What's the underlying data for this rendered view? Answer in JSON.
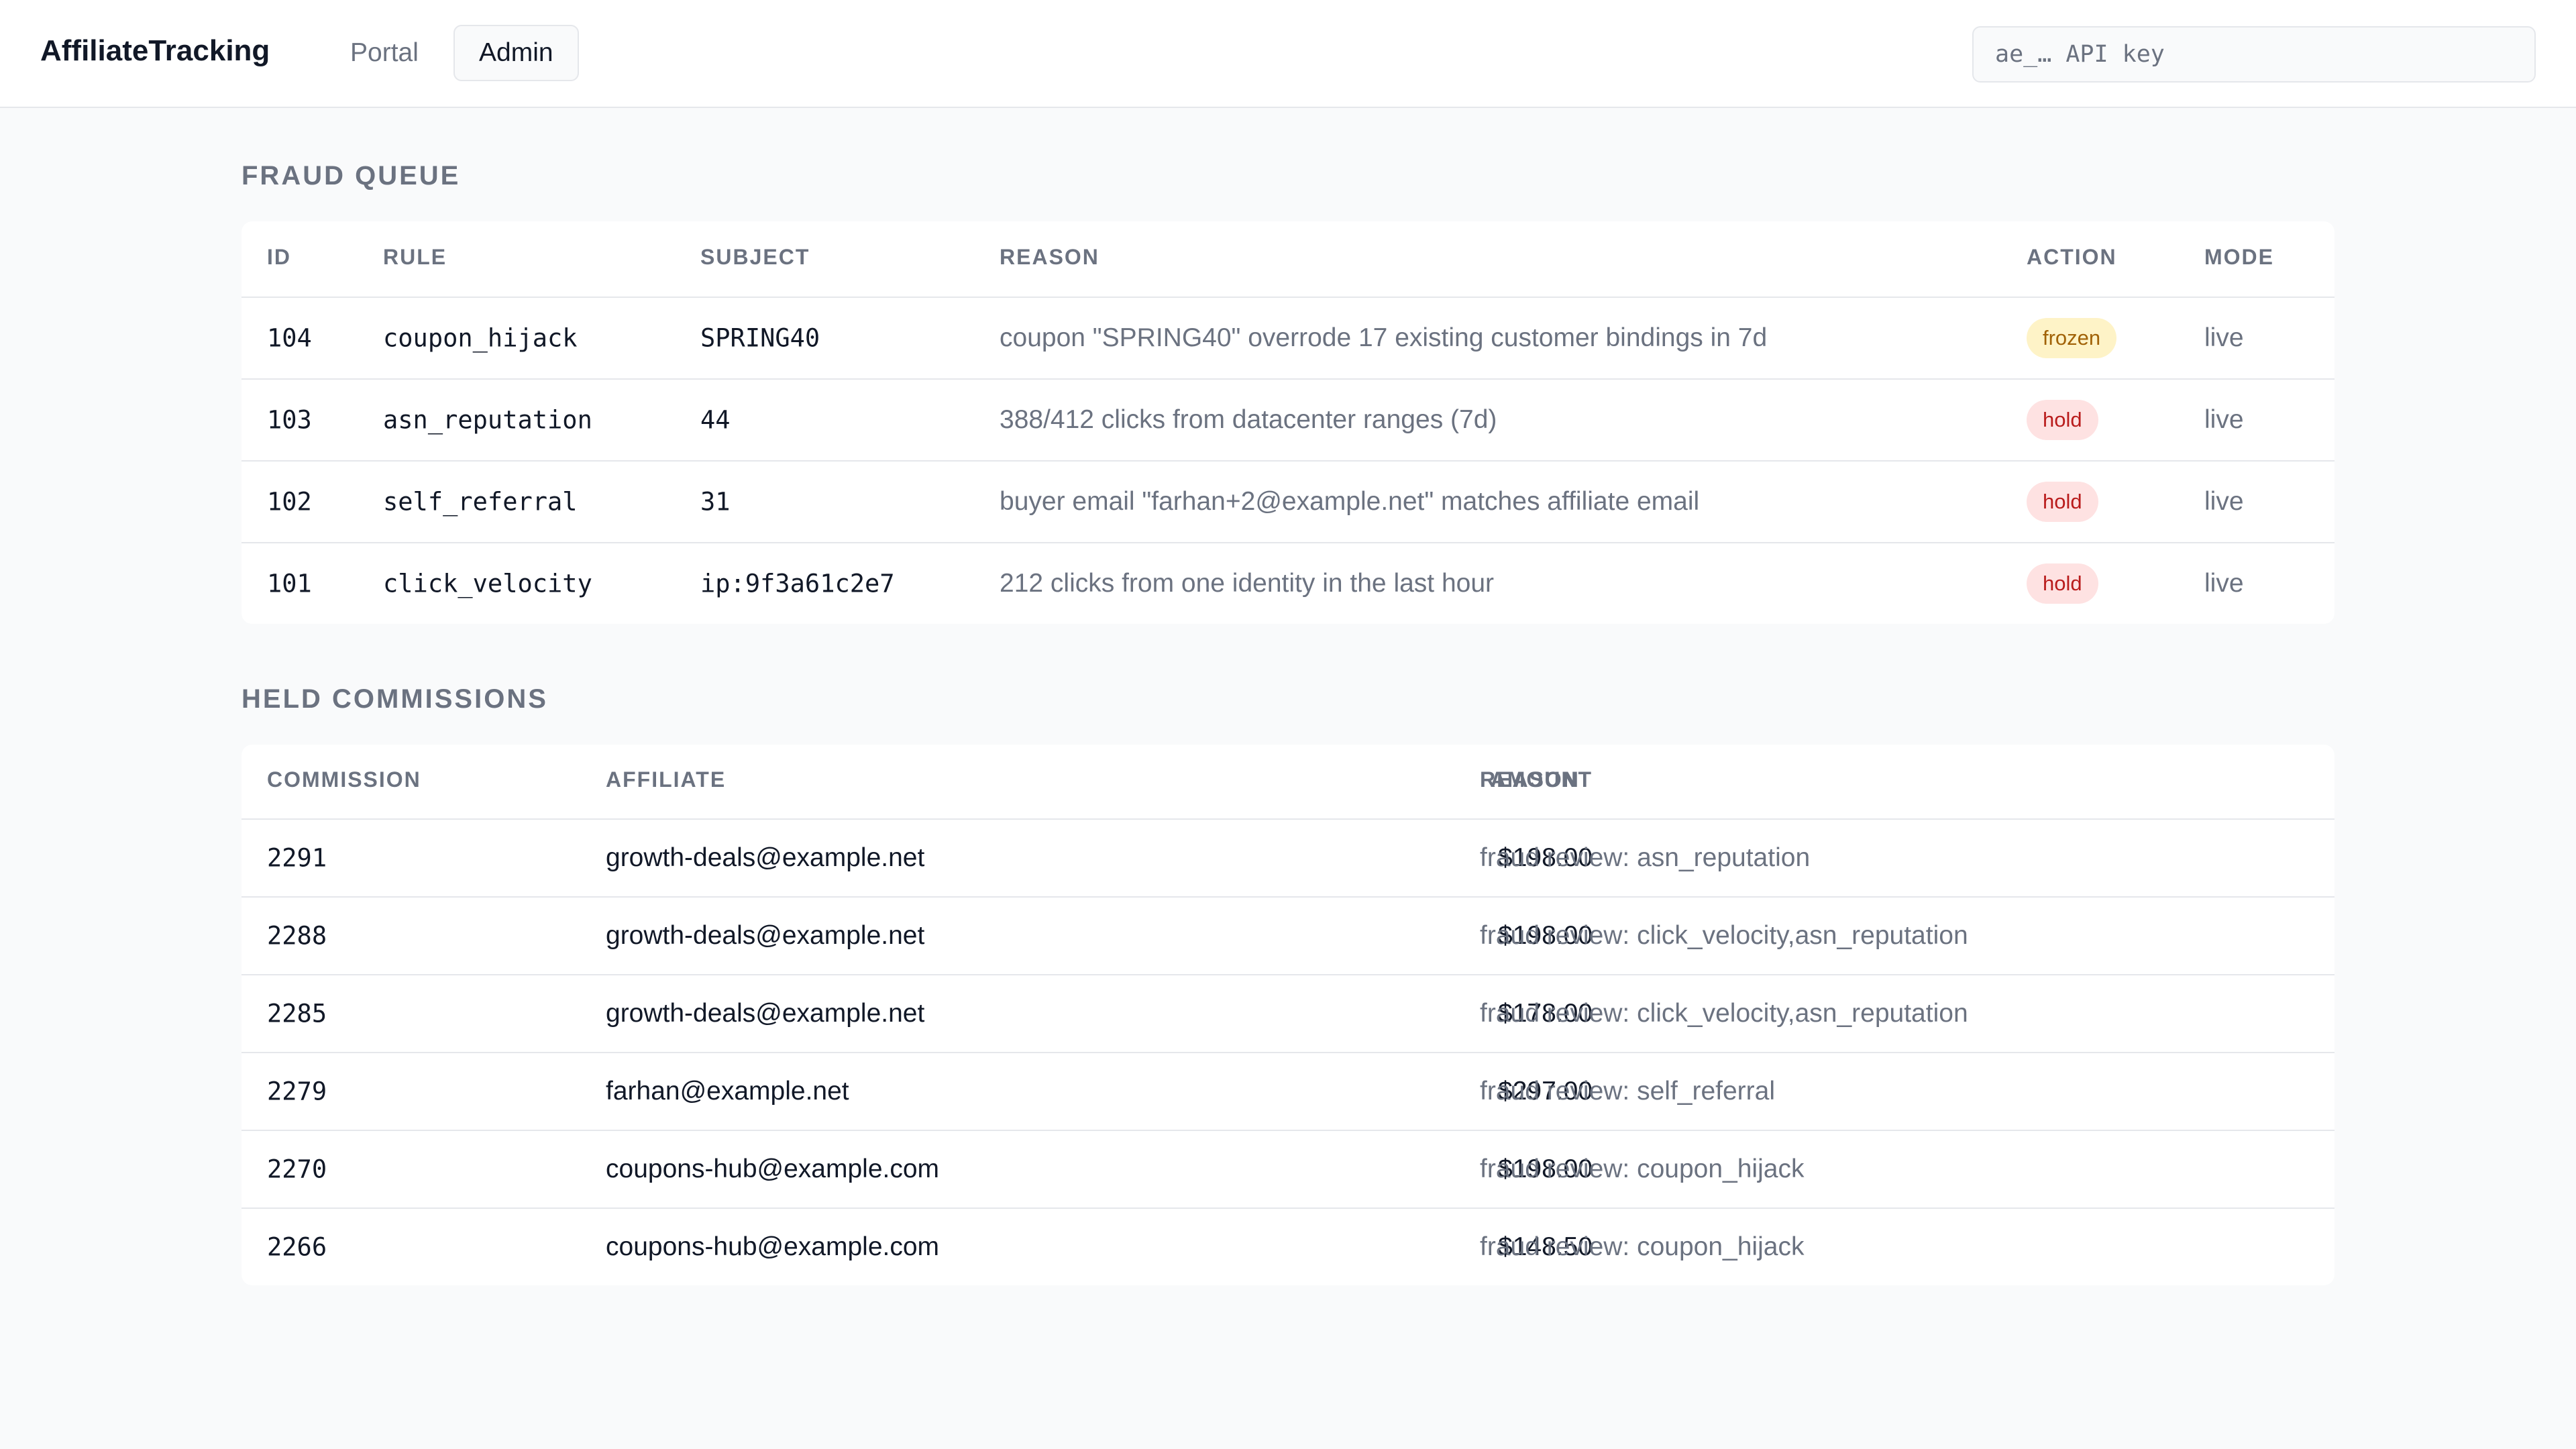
{
  "header": {
    "brand": "AffiliateTracking",
    "tabs": [
      {
        "label": "Portal",
        "active": false
      },
      {
        "label": "Admin",
        "active": true
      }
    ],
    "api_key_placeholder": "ae_… API key"
  },
  "fraud_queue": {
    "title": "FRAUD QUEUE",
    "columns": [
      "ID",
      "RULE",
      "SUBJECT",
      "REASON",
      "ACTION",
      "MODE"
    ],
    "rows": [
      {
        "id": "104",
        "rule": "coupon_hijack",
        "subject": "SPRING40",
        "reason": "coupon \"SPRING40\" overrode 17 existing customer bindings in 7d",
        "action": "frozen",
        "mode": "live"
      },
      {
        "id": "103",
        "rule": "asn_reputation",
        "subject": "44",
        "reason": "388/412 clicks from datacenter ranges (7d)",
        "action": "hold",
        "mode": "live"
      },
      {
        "id": "102",
        "rule": "self_referral",
        "subject": "31",
        "reason": "buyer email \"farhan+2@example.net\" matches affiliate email",
        "action": "hold",
        "mode": "live"
      },
      {
        "id": "101",
        "rule": "click_velocity",
        "subject": "ip:9f3a61c2e7",
        "reason": "212 clicks from one identity in the last hour",
        "action": "hold",
        "mode": "live"
      }
    ]
  },
  "held_commissions": {
    "title": "HELD COMMISSIONS",
    "columns": [
      "COMMISSION",
      "AFFILIATE",
      "AMOUNT",
      "REASON"
    ],
    "rows": [
      {
        "commission": "2291",
        "affiliate": "growth-deals@example.net",
        "amount": "$198.00",
        "reason": "fraud review: asn_reputation"
      },
      {
        "commission": "2288",
        "affiliate": "growth-deals@example.net",
        "amount": "$198.00",
        "reason": "fraud review: click_velocity,asn_reputation"
      },
      {
        "commission": "2285",
        "affiliate": "growth-deals@example.net",
        "amount": "$178.00",
        "reason": "fraud review: click_velocity,asn_reputation"
      },
      {
        "commission": "2279",
        "affiliate": "farhan@example.net",
        "amount": "$297.00",
        "reason": "fraud review: self_referral"
      },
      {
        "commission": "2270",
        "affiliate": "coupons-hub@example.com",
        "amount": "$198.00",
        "reason": "fraud review: coupon_hijack"
      },
      {
        "commission": "2266",
        "affiliate": "coupons-hub@example.com",
        "amount": "$148.50",
        "reason": "fraud review: coupon_hijack"
      }
    ]
  }
}
